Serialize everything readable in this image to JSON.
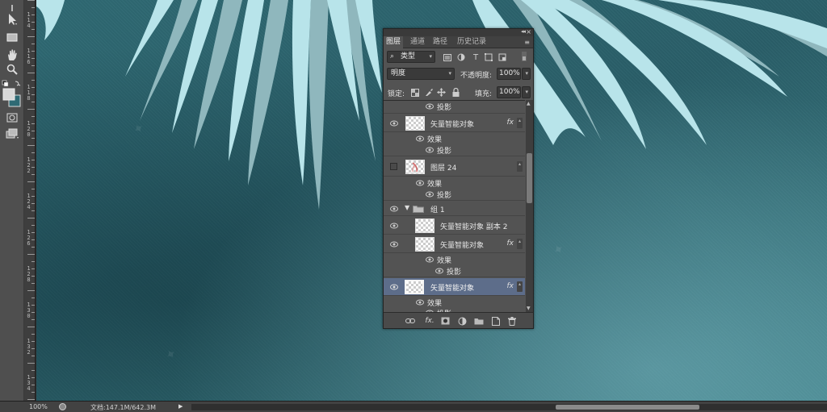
{
  "panel": {
    "tabs": [
      "图层",
      "通道",
      "路径",
      "历史记录"
    ],
    "filter": {
      "icon": "search-icon",
      "label": "类型"
    },
    "blend_mode": "明度",
    "opacity_label": "不透明度:",
    "opacity_value": "100%",
    "lock_label": "锁定:",
    "fill_label": "填充:",
    "fill_value": "100%",
    "layers": [
      {
        "kind": "effect",
        "label": "投影"
      },
      {
        "kind": "layer",
        "label": "矢量智能对象",
        "fx": "fx"
      },
      {
        "kind": "effect-group",
        "label": "效果"
      },
      {
        "kind": "effect",
        "label": "投影"
      },
      {
        "kind": "layer",
        "label": "图层 24",
        "visible": false
      },
      {
        "kind": "effect-group",
        "label": "效果"
      },
      {
        "kind": "effect",
        "label": "投影"
      },
      {
        "kind": "group",
        "label": "组 1"
      },
      {
        "kind": "layer",
        "label": "矢量智能对象 副本 2"
      },
      {
        "kind": "layer",
        "label": "矢量智能对象",
        "fx": "fx"
      },
      {
        "kind": "effect-group",
        "label": "效果"
      },
      {
        "kind": "effect",
        "label": "投影"
      },
      {
        "kind": "layer",
        "label": "矢量智能对象",
        "fx": "fx",
        "selected": true
      },
      {
        "kind": "effect-group",
        "label": "效果"
      },
      {
        "kind": "effect",
        "label": "投影"
      }
    ],
    "bottom_icons": [
      "link-icon",
      "fx-icon",
      "mask-icon",
      "adjustment-icon",
      "folder-icon",
      "new-layer-icon",
      "trash-icon"
    ],
    "fx_glyph": "fx."
  },
  "status": {
    "zoom": "100%",
    "doc_info": "文档:147.1M/642.3M",
    "arrow": "▶"
  },
  "ruler": {
    "numbers": [
      "1 1 4",
      "1 1 6",
      "1 1 8",
      "1 2 0",
      "1 2 2",
      "1 2 4",
      "1 2 6",
      "1 2 8",
      "1 3 0",
      "1 3 2",
      "1 3 4"
    ]
  },
  "colors": {
    "canvas": "#2f6a74",
    "leaf_light": "#b8e4ea",
    "leaf_dark": "#8fb7bd",
    "panel": "#535353",
    "selected_row": "#5d6d8a"
  }
}
